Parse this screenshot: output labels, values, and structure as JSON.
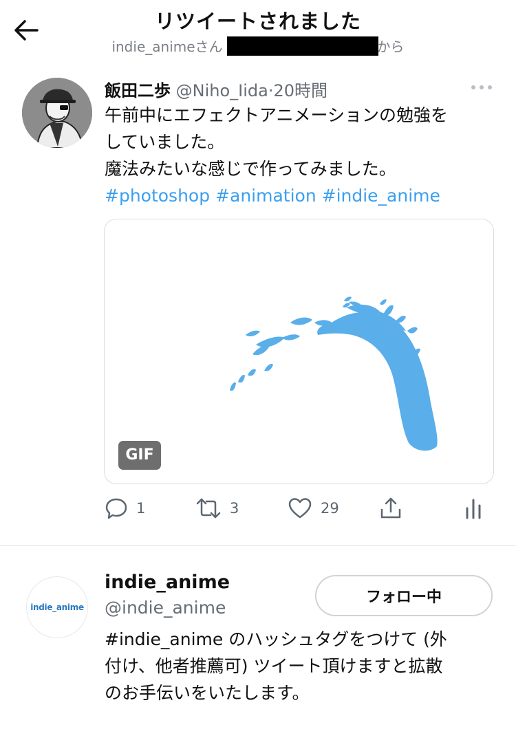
{
  "header": {
    "title": "リツイートされました",
    "sub_prefix": "indie_animeさん",
    "sub_suffix": "から"
  },
  "tweet": {
    "author_name": "飯田二歩",
    "author_handle": "@Niho_Iida",
    "separator": "·",
    "time": "20時間",
    "text_lines": [
      "午前中にエフェクトアニメーションの勉強を",
      "していました。",
      "魔法みたいな感じで作ってみました。"
    ],
    "hashtags": [
      "#photoshop",
      "#animation",
      "#indie_anime"
    ],
    "media_badge": "GIF",
    "counts": {
      "replies": "1",
      "retweets": "3",
      "likes": "29"
    }
  },
  "profile": {
    "name": "indie_anime",
    "handle": "@indie_anime",
    "avatar_text": "indie_anime",
    "follow_label": "フォロー中",
    "bio_lines": [
      "#indie_anime のハッシュタグをつけて (外",
      "付け、他者推薦可) ツイート頂けますと拡散",
      "のお手伝いをいたします。"
    ]
  },
  "colors": {
    "accent": "#3a9ff0",
    "splash": "#5aaeea",
    "muted": "#666d74"
  },
  "icons": [
    "back-arrow-icon",
    "more-icon",
    "reply-icon",
    "retweet-icon",
    "like-icon",
    "share-icon",
    "analytics-icon"
  ]
}
